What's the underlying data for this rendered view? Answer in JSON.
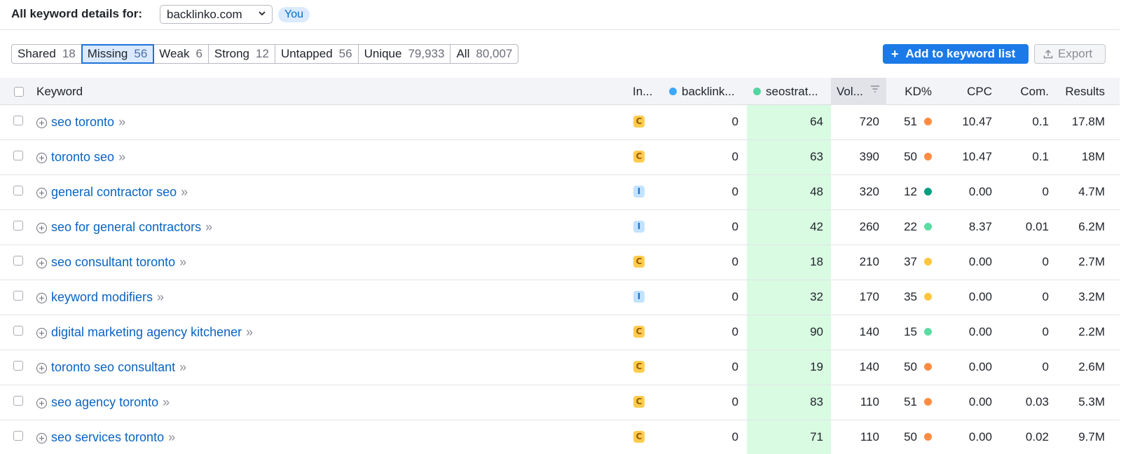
{
  "header": {
    "label": "All keyword details for:",
    "domain": "backlinko.com",
    "you_badge": "You"
  },
  "tabs": [
    {
      "label": "Shared",
      "count": "18",
      "active": false
    },
    {
      "label": "Missing",
      "count": "56",
      "active": true
    },
    {
      "label": "Weak",
      "count": "6",
      "active": false
    },
    {
      "label": "Strong",
      "count": "12",
      "active": false
    },
    {
      "label": "Untapped",
      "count": "56",
      "active": false
    },
    {
      "label": "Unique",
      "count": "79,933",
      "active": false
    },
    {
      "label": "All",
      "count": "80,007",
      "active": false
    }
  ],
  "actions": {
    "add_label": "Add to keyword list",
    "export_label": "Export"
  },
  "columns": {
    "keyword": "Keyword",
    "intent": "In...",
    "backlinko": "backlink...",
    "seostrat": "seostrat...",
    "volume": "Vol...",
    "kd": "KD%",
    "cpc": "CPC",
    "com": "Com.",
    "results": "Results"
  },
  "colors": {
    "backlinko_dot": "#3ba9ff",
    "seostrat_dot": "#52d6a0",
    "kd_orange": "#ff8c42",
    "kd_dark_green": "#009f81",
    "kd_light_green": "#59dda2",
    "kd_yellow": "#ffc53d",
    "intent_commercial": "#ffcc4d",
    "intent_informational": "#c2e3ff"
  },
  "rows": [
    {
      "keyword": "seo toronto",
      "intent": "C",
      "backlinko": "0",
      "seostrat": "64",
      "volume": "720",
      "kd": "51",
      "kd_color": "#ff8c42",
      "cpc": "10.47",
      "com": "0.1",
      "results": "17.8M"
    },
    {
      "keyword": "toronto seo",
      "intent": "C",
      "backlinko": "0",
      "seostrat": "63",
      "volume": "390",
      "kd": "50",
      "kd_color": "#ff8c42",
      "cpc": "10.47",
      "com": "0.1",
      "results": "18M"
    },
    {
      "keyword": "general contractor seo",
      "intent": "I",
      "backlinko": "0",
      "seostrat": "48",
      "volume": "320",
      "kd": "12",
      "kd_color": "#009f81",
      "cpc": "0.00",
      "com": "0",
      "results": "4.7M"
    },
    {
      "keyword": "seo for general contractors",
      "intent": "I",
      "backlinko": "0",
      "seostrat": "42",
      "volume": "260",
      "kd": "22",
      "kd_color": "#59dda2",
      "cpc": "8.37",
      "com": "0.01",
      "results": "6.2M"
    },
    {
      "keyword": "seo consultant toronto",
      "intent": "C",
      "backlinko": "0",
      "seostrat": "18",
      "volume": "210",
      "kd": "37",
      "kd_color": "#ffc53d",
      "cpc": "0.00",
      "com": "0",
      "results": "2.7M"
    },
    {
      "keyword": "keyword modifiers",
      "intent": "I",
      "backlinko": "0",
      "seostrat": "32",
      "volume": "170",
      "kd": "35",
      "kd_color": "#ffc53d",
      "cpc": "0.00",
      "com": "0",
      "results": "3.2M"
    },
    {
      "keyword": "digital marketing agency kitchener",
      "intent": "C",
      "backlinko": "0",
      "seostrat": "90",
      "volume": "140",
      "kd": "15",
      "kd_color": "#59dda2",
      "cpc": "0.00",
      "com": "0",
      "results": "2.2M"
    },
    {
      "keyword": "toronto seo consultant",
      "intent": "C",
      "backlinko": "0",
      "seostrat": "19",
      "volume": "140",
      "kd": "50",
      "kd_color": "#ff8c42",
      "cpc": "0.00",
      "com": "0",
      "results": "2.6M"
    },
    {
      "keyword": "seo agency toronto",
      "intent": "C",
      "backlinko": "0",
      "seostrat": "83",
      "volume": "110",
      "kd": "51",
      "kd_color": "#ff8c42",
      "cpc": "0.00",
      "com": "0.03",
      "results": "5.3M"
    },
    {
      "keyword": "seo services toronto",
      "intent": "C",
      "backlinko": "0",
      "seostrat": "71",
      "volume": "110",
      "kd": "50",
      "kd_color": "#ff8c42",
      "cpc": "0.00",
      "com": "0.02",
      "results": "9.7M"
    }
  ]
}
